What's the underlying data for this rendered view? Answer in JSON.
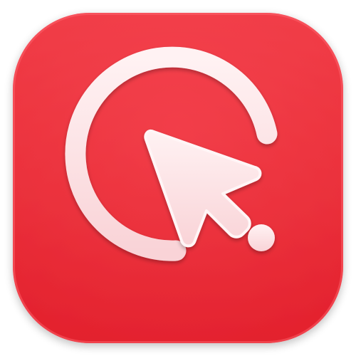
{
  "icon": {
    "name": "cursor-click-app-icon",
    "colors": {
      "background_top": "#ef3a44",
      "background_bottom": "#e3212d",
      "background_edge": "#d11a26",
      "glyph": "#fde4e6",
      "glyph_highlight": "#ffffff",
      "glyph_shadow": "#f7c9cd"
    },
    "glyphs": [
      "progress-ring-icon",
      "cursor-arrow-icon",
      "dot-icon"
    ]
  }
}
